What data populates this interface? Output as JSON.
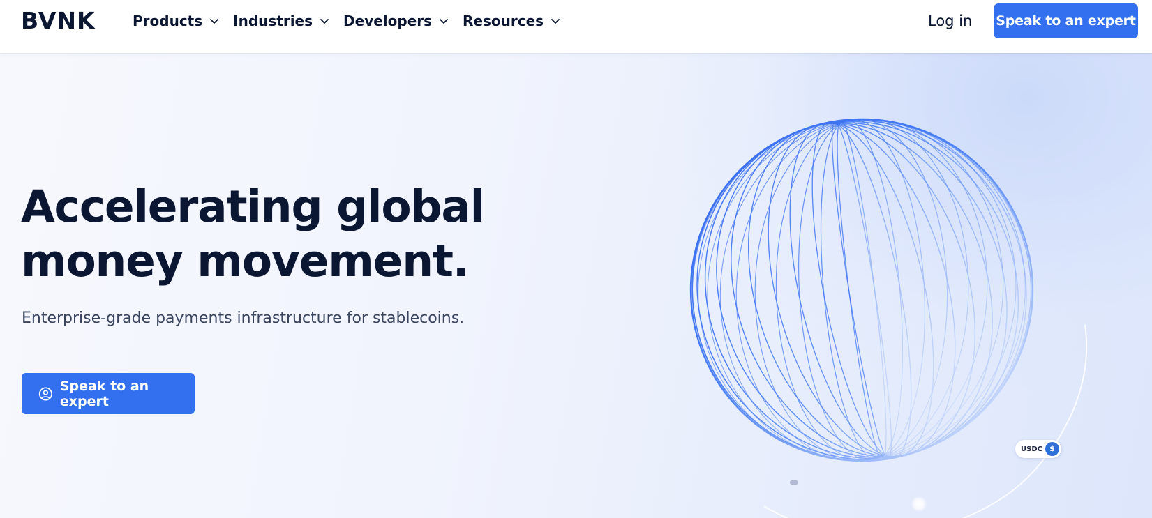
{
  "header": {
    "logo": "BVNK",
    "nav": [
      {
        "label": "Products",
        "icon": "chevron-down-icon"
      },
      {
        "label": "Industries",
        "icon": "chevron-down-icon"
      },
      {
        "label": "Developers",
        "icon": "chevron-down-icon"
      },
      {
        "label": "Resources",
        "icon": "chevron-down-icon"
      }
    ],
    "login_label": "Log in",
    "cta_label": "Speak to an expert"
  },
  "hero": {
    "headline_line1": "Accelerating global",
    "headline_line2": "money movement.",
    "subheadline": "Enterprise-grade payments infrastructure for stablecoins.",
    "cta_label": "Speak to an expert",
    "cta_icon": "person-circle-icon",
    "badge": {
      "label": "USDC",
      "icon": "usdc-coin-icon",
      "coin_symbol": "$"
    }
  },
  "colors": {
    "brand_blue": "#3370f0",
    "text_dark": "#0b1633",
    "globe_line": "#3d72f2"
  }
}
